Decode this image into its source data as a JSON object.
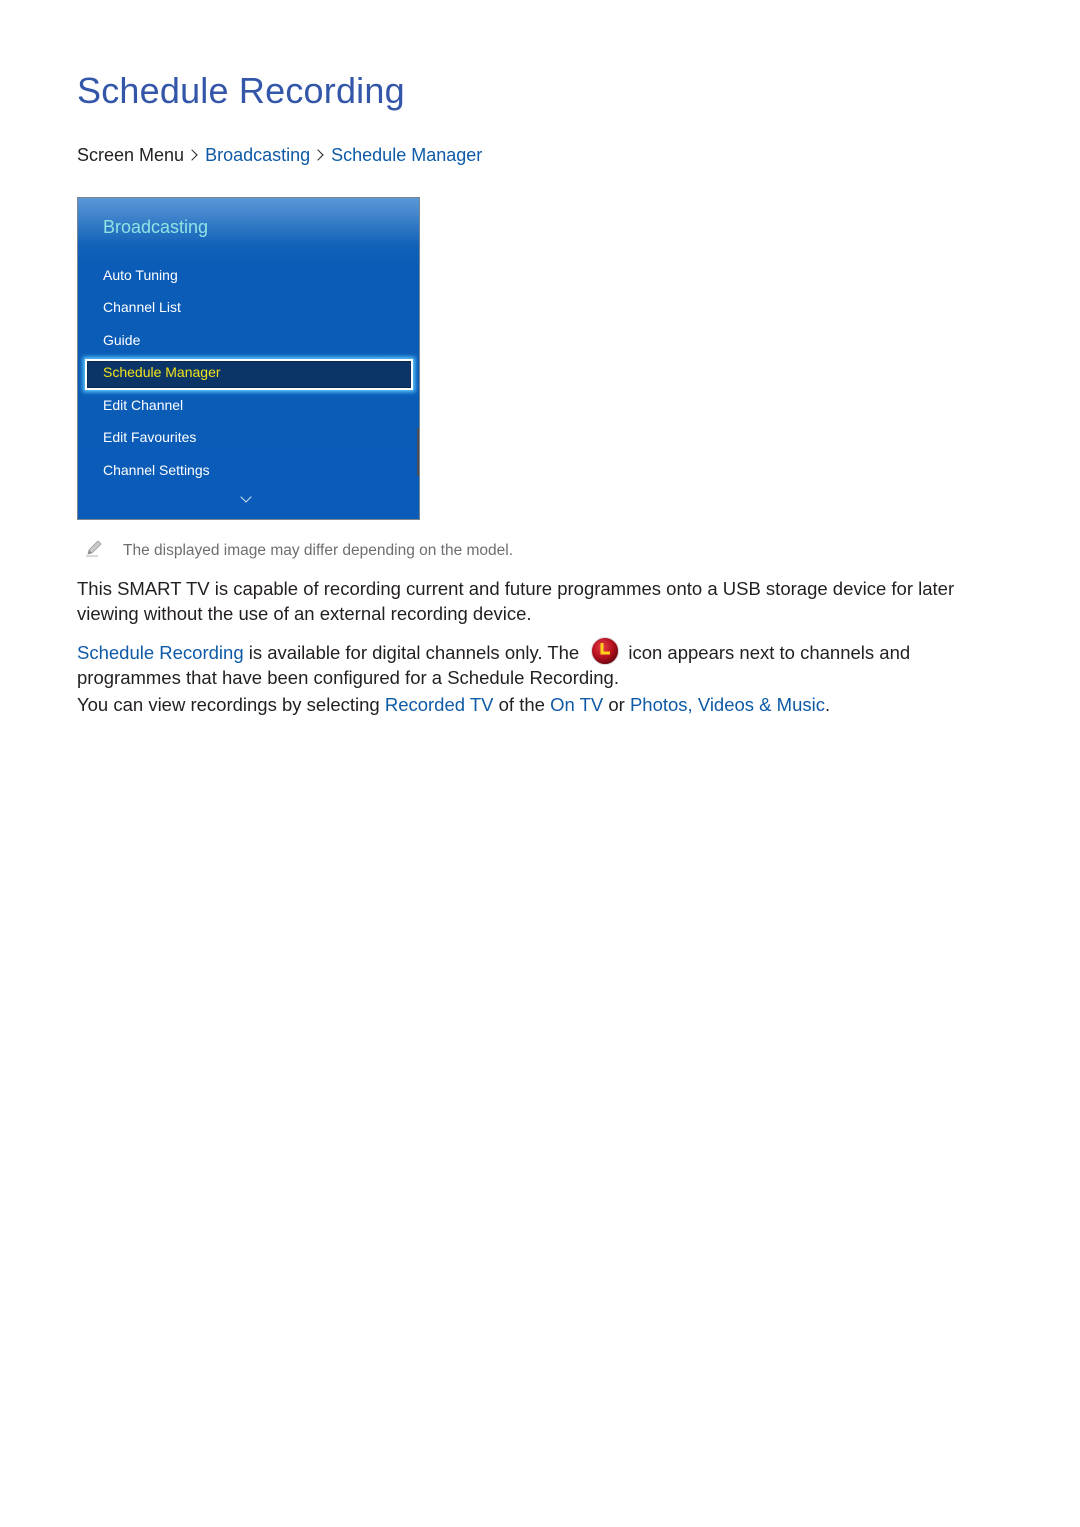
{
  "page": {
    "title": "Schedule Recording"
  },
  "breadcrumb": {
    "root": "Screen Menu",
    "items": [
      "Broadcasting",
      "Schedule Manager"
    ]
  },
  "tv_menu": {
    "title": "Broadcasting",
    "items": [
      {
        "label": "Auto Tuning",
        "selected": false
      },
      {
        "label": "Channel List",
        "selected": false
      },
      {
        "label": "Guide",
        "selected": false
      },
      {
        "label": "Schedule Manager",
        "selected": true
      },
      {
        "label": "Edit Channel",
        "selected": false
      },
      {
        "label": "Edit Favourites",
        "selected": false
      },
      {
        "label": "Channel Settings",
        "selected": false
      }
    ],
    "more_indicator": "chevron-down-icon"
  },
  "note": {
    "icon": "pencil-icon",
    "text": "The displayed image may differ depending on the model."
  },
  "paragraphs": {
    "p1": "This SMART TV is capable of recording current and future programmes onto a USB storage device for later viewing without the use of an external recording device.",
    "p2": {
      "link": "Schedule Recording",
      "before_icon": " is available for digital channels only. The ",
      "icon": "schedule-recording-clock-icon",
      "after_icon": "icon appears next to channels and programmes that have been configured for a Schedule Recording."
    },
    "p3": {
      "text1": "You can view recordings by selecting ",
      "link1": "Recorded TV",
      "text2": " of the ",
      "link2": "On TV",
      "text3": " or ",
      "link3": "Photos, Videos & Music",
      "text4": "."
    }
  },
  "colors": {
    "title": "#3356a8",
    "link": "#0e5aa7",
    "body_text": "#231f20",
    "note_text": "#6d6e71",
    "menu_bg": "#0a5cb8",
    "menu_title": "#8fe3e6",
    "menu_selected_text": "#f2e21b",
    "record_icon": "#c8102e"
  }
}
